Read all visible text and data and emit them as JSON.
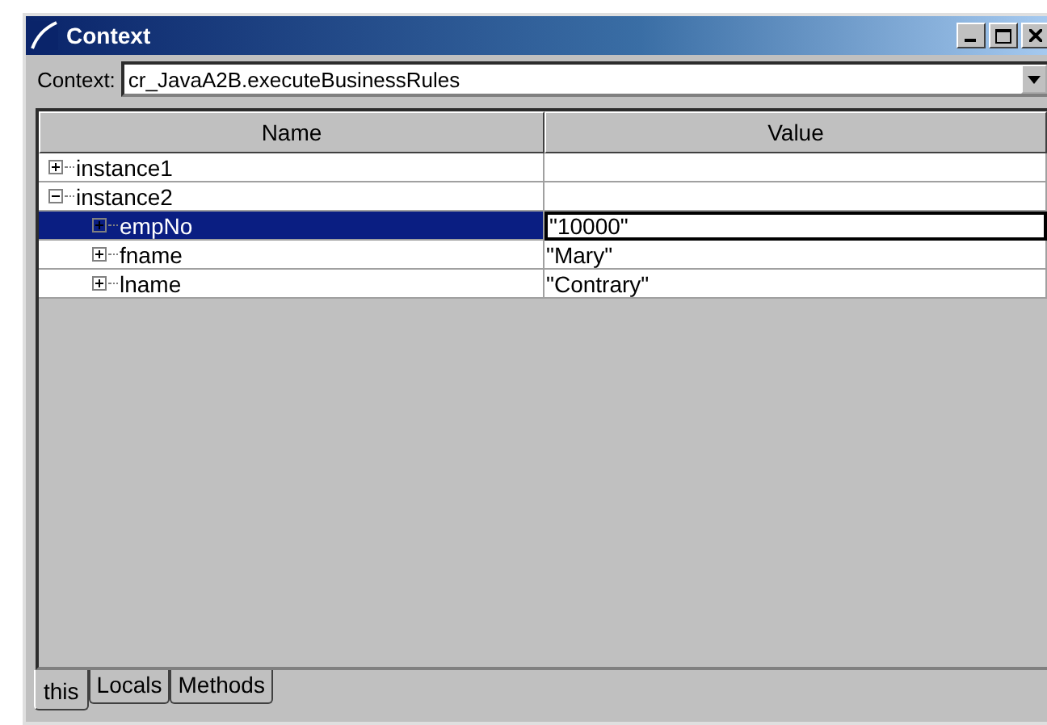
{
  "window": {
    "title": "Context"
  },
  "context": {
    "label": "Context:",
    "value": "cr_JavaA2B.executeBusinessRules"
  },
  "table": {
    "columns": [
      "Name",
      "Value"
    ],
    "rows": [
      {
        "name": "instance1",
        "expanded": false,
        "selected": false,
        "children": []
      },
      {
        "name": "instance2",
        "expanded": true,
        "selected": false,
        "children": [
          {
            "name": "empNo",
            "value": "\"10000\"",
            "expanded": false,
            "selected": true
          },
          {
            "name": "fname",
            "value": "\"Mary\"",
            "expanded": false,
            "selected": false
          },
          {
            "name": "lname",
            "value": "\"Contrary\"",
            "expanded": false,
            "selected": false
          }
        ]
      }
    ]
  },
  "tabs": [
    {
      "label": "this",
      "selected": true
    },
    {
      "label": "Locals",
      "selected": false
    },
    {
      "label": "Methods",
      "selected": false
    }
  ]
}
